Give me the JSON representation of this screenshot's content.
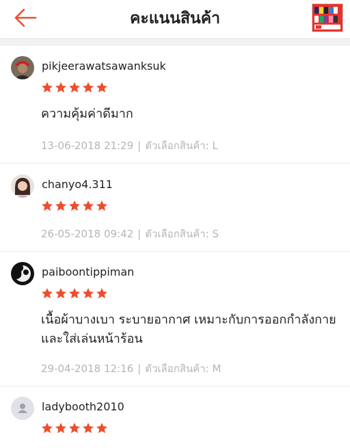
{
  "header": {
    "title": "คะแนนสินค้า",
    "back_icon": "arrow-left-icon",
    "accent_color": "#ee4d2d"
  },
  "star_color": "#ee4d2d",
  "reviews": [
    {
      "username": "pikjeerawatsawanksuk",
      "rating": 5,
      "comment": "ความคุ้มค่าดีมาก",
      "comment_line2": "",
      "date": "13-06-2018 21:29",
      "separator": "|",
      "variation_label": "ตัวเลือกสินค้า:",
      "variation_value": "L"
    },
    {
      "username": "chanyo4.311",
      "rating": 5,
      "comment": "",
      "comment_line2": "",
      "date": "26-05-2018 09:42",
      "separator": "|",
      "variation_label": "ตัวเลือกสินค้า:",
      "variation_value": "S"
    },
    {
      "username": "paiboontippiman",
      "rating": 5,
      "comment": "เนื้อผ้าบางเบา ระบายอากาศ เหมาะกับการออกกำลังกาย",
      "comment_line2": "และใส่เล่นหน้าร้อน",
      "date": "29-04-2018 12:16",
      "separator": "|",
      "variation_label": "ตัวเลือกสินค้า:",
      "variation_value": "M"
    },
    {
      "username": "ladybooth2010",
      "rating": 5,
      "comment": "",
      "comment_line2": "",
      "date": "",
      "separator": "",
      "variation_label": "",
      "variation_value": ""
    }
  ]
}
